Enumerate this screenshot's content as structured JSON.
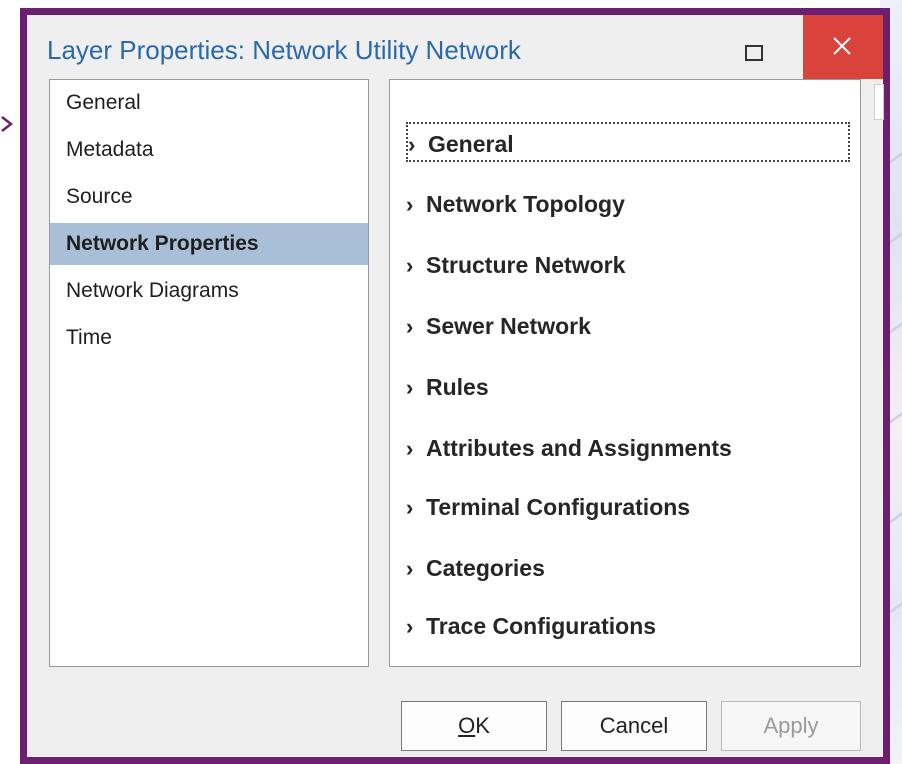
{
  "window": {
    "title": "Layer Properties: Network Utility Network"
  },
  "icons": {
    "maximize": "maximize-icon",
    "close": "close-icon",
    "chevron": "chevron-right-icon",
    "pointer": "pointer-arrow-icon"
  },
  "colors": {
    "frame": "#6b1f6e",
    "title": "#2a6aa8",
    "close": "#d9433c",
    "selected": "#a9bfd8"
  },
  "nav": {
    "items": [
      {
        "label": "General"
      },
      {
        "label": "Metadata"
      },
      {
        "label": "Source"
      },
      {
        "label": "Network Properties"
      },
      {
        "label": "Network Diagrams"
      },
      {
        "label": "Time"
      }
    ],
    "selected_index": 3
  },
  "content": {
    "sections": [
      {
        "label": "General"
      },
      {
        "label": "Network Topology"
      },
      {
        "label": "Structure Network"
      },
      {
        "label": "Sewer Network"
      },
      {
        "label": "Rules"
      },
      {
        "label": "Attributes and Assignments"
      },
      {
        "label": "Terminal Configurations"
      },
      {
        "label": "Categories"
      },
      {
        "label": "Trace Configurations"
      }
    ],
    "focused_index": 0
  },
  "buttons": {
    "ok_mnemonic": "O",
    "ok_rest": "K",
    "cancel": "Cancel",
    "apply": "Apply"
  }
}
